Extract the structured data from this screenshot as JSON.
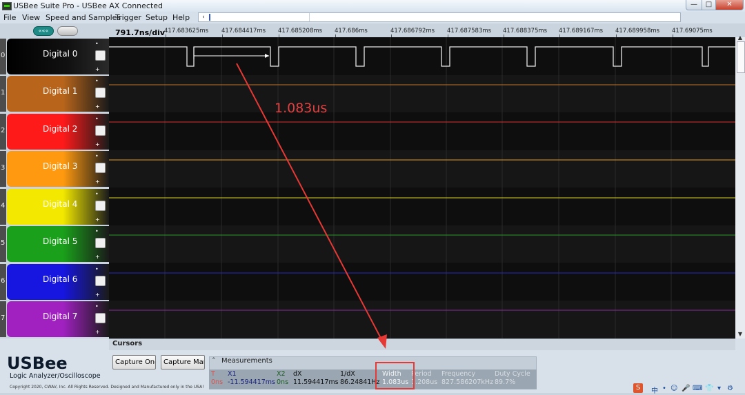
{
  "window": {
    "title": "USBee Suite Pro - USBee AX Connected",
    "minimize_glyph": "—",
    "maximize_glyph": "□",
    "close_glyph": "✕"
  },
  "menu": [
    "File",
    "View",
    "Speed and Samples",
    "Trigger",
    "Setup",
    "Help"
  ],
  "overview": {
    "left_arrow": "‹"
  },
  "toggles": {
    "a_label": "«««"
  },
  "ruler": {
    "time_per_div": "791.7ns/div",
    "ticks": [
      "417.683625ms",
      "417.684417ms",
      "417.685208ms",
      "417.686ms",
      "417.686792ms",
      "417.687583ms",
      "417.688375ms",
      "417.689167ms",
      "417.689958ms",
      "417.69075ms"
    ]
  },
  "channels": [
    {
      "num": "0",
      "name": "Digital 0",
      "color": "#000000",
      "trace": "#e8e8e8"
    },
    {
      "num": "1",
      "name": "Digital 1",
      "color": "#b8651b",
      "trace": "#c0722a"
    },
    {
      "num": "2",
      "name": "Digital 2",
      "color": "#ff1a1a",
      "trace": "#e03030"
    },
    {
      "num": "3",
      "name": "Digital 3",
      "color": "#ff9a10",
      "trace": "#e89a20"
    },
    {
      "num": "4",
      "name": "Digital 4",
      "color": "#f2e800",
      "trace": "#d8d020"
    },
    {
      "num": "5",
      "name": "Digital 5",
      "color": "#1aa01a",
      "trace": "#2a9a2a"
    },
    {
      "num": "6",
      "name": "Digital 6",
      "color": "#1616e0",
      "trace": "#2828c8"
    },
    {
      "num": "7",
      "name": "Digital 7",
      "color": "#a020c0",
      "trace": "#8a2a9a"
    }
  ],
  "channel_marks": {
    "top": "•",
    "bottom": "+"
  },
  "scrollbar": {
    "up": "▲",
    "down": "▼"
  },
  "annotation": {
    "text": "1.083us",
    "color": "#e53935"
  },
  "cursors_label": "Cursors",
  "brand": {
    "name": "USBee",
    "subtitle": "Logic Analyzer/Oscilloscope",
    "copyright": "Copyright 2020, CWAV, Inc. All Rights Reserved. Designed and Manufactured only in the USA!"
  },
  "buttons": {
    "capture_once": "Capture Once",
    "capture_manual": "Capture Manual"
  },
  "measurements": {
    "title": "Measurements",
    "collapse_glyph": "⌃",
    "headers": [
      "T",
      "X1",
      "X2",
      "dX",
      "1/dX",
      "Width",
      "Period",
      "Frequency",
      "Duty Cycle"
    ],
    "values": [
      "0ns",
      "-11.594417ms",
      "0ns",
      "11.594417ms",
      "86.24841Hz",
      "1.083us",
      "1.208us",
      "827.586207kHz",
      "89.7%"
    ]
  },
  "tray": {
    "ime_badge": "S",
    "items": [
      "中",
      "•",
      "☺",
      "🎤",
      "⌨",
      "👕",
      "▾",
      "⚙"
    ]
  }
}
